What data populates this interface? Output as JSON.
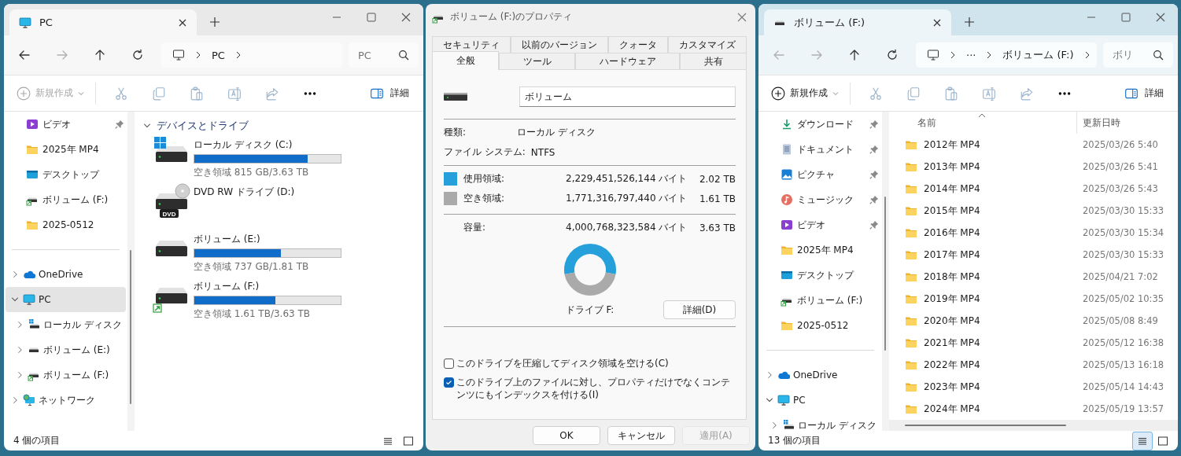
{
  "windows": [
    {
      "kind": "explorer",
      "active": false,
      "tab": {
        "title": "PC",
        "kind": "pc"
      },
      "back_enabled": true,
      "forward_enabled": false,
      "address": [
        "PC"
      ],
      "search": {
        "placeholder": "PC"
      },
      "toolbar": {
        "new_label": "新規作成",
        "new_disabled": true,
        "details_label": "詳細"
      },
      "quick_access": [
        {
          "label": "ビデオ",
          "kind": "video",
          "pinned": true
        },
        {
          "label": "2025年 MP4",
          "kind": "folder",
          "pinned": false
        },
        {
          "label": "デスクトップ",
          "kind": "desktop",
          "pinned": false
        },
        {
          "label": "ボリューム (F:)",
          "kind": "drive-shared",
          "pinned": false
        },
        {
          "label": "2025-0512",
          "kind": "folder",
          "pinned": false
        }
      ],
      "tree": [
        {
          "label": "OneDrive",
          "kind": "onedrive",
          "expanded": false,
          "selected": false
        },
        {
          "label": "PC",
          "kind": "pc",
          "expanded": true,
          "selected": true,
          "children": [
            {
              "label": "ローカル ディスク",
              "kind": "drive-system",
              "expanded": false,
              "selected": false
            },
            {
              "label": "ボリューム (E:)",
              "kind": "drive",
              "expanded": false,
              "selected": false
            },
            {
              "label": "ボリューム (F:)",
              "kind": "drive-shared",
              "expanded": false,
              "selected": false
            }
          ]
        },
        {
          "label": "ネットワーク",
          "kind": "network",
          "expanded": false,
          "selected": false
        }
      ],
      "content": {
        "kind": "drives",
        "group": {
          "title": "デバイスとドライブ",
          "expanded": true
        },
        "drives": [
          {
            "name": "ローカル ディスク (C:)",
            "kind": "system",
            "level": 0.776,
            "free": "空き領域 815 GB/3.63 TB"
          },
          {
            "name": "DVD RW ドライブ (D:)",
            "kind": "dvd",
            "badge": "DVD"
          },
          {
            "name": "ボリューム (E:)",
            "kind": "drive",
            "level": 0.593,
            "free": "空き領域 737 GB/1.81 TB"
          },
          {
            "name": "ボリューム (F:)",
            "kind": "shared",
            "level": 0.556,
            "free": "空き領域 1.61 TB/3.63 TB"
          }
        ]
      },
      "status": {
        "text": "4 個の項目",
        "views": [
          {
            "kind": "details",
            "selected": false
          },
          {
            "kind": "tiles",
            "selected": false
          }
        ]
      }
    },
    {
      "kind": "properties",
      "title": "ボリューム (F:)のプロパティ",
      "tab_rows": [
        {
          "tabs": [
            {
              "label": "セキュリティ",
              "selected": false
            },
            {
              "label": "以前のバージョン",
              "selected": false
            },
            {
              "label": "クォータ",
              "selected": false
            },
            {
              "label": "カスタマイズ",
              "selected": false
            }
          ]
        },
        {
          "tabs": [
            {
              "label": "全般",
              "selected": true
            },
            {
              "label": "ツール",
              "selected": false
            },
            {
              "label": "ハードウェア",
              "selected": false
            },
            {
              "label": "共有",
              "selected": false
            }
          ]
        }
      ],
      "name_value": "ボリューム",
      "info": [
        {
          "label": "種類:",
          "value": "ローカル ディスク"
        },
        {
          "label": "ファイル システム:",
          "value": "NTFS"
        }
      ],
      "usage": [
        {
          "label": "使用領域:",
          "bytes": "2,229,451,526,144 バイト",
          "size": "2.02 TB",
          "color": "#26a0da"
        },
        {
          "label": "空き領域:",
          "bytes": "1,771,316,797,440 バイト",
          "size": "1.61 TB",
          "color": "#aaaaaa"
        }
      ],
      "capacity": {
        "label": "容量:",
        "bytes": "4,000,768,323,584 バイト",
        "size": "3.63 TB"
      },
      "chart_data": {
        "type": "donut",
        "values": [
          55.7,
          44.3
        ]
      },
      "drive_label": "ドライブ F:",
      "details_button": "詳細(D)",
      "options": [
        {
          "label": "このドライブを圧縮してディスク領域を空ける(C)",
          "checked": false
        },
        {
          "label": "このドライブ上のファイルに対し、プロパティだけでなくコンテンツにもインデックスを付ける(I)",
          "checked": true
        }
      ],
      "buttons": [
        {
          "label": "OK",
          "disabled": false
        },
        {
          "label": "キャンセル",
          "disabled": false
        },
        {
          "label": "適用(A)",
          "disabled": true
        }
      ]
    },
    {
      "kind": "explorer",
      "active": true,
      "tab": {
        "title": "ボリューム (F:)",
        "kind": "drive"
      },
      "back_enabled": false,
      "forward_enabled": false,
      "address": [
        "···",
        "ボリューム (F:)"
      ],
      "search": {
        "placeholder": "ボリ"
      },
      "toolbar": {
        "new_label": "新規作成",
        "new_disabled": false,
        "details_label": "詳細"
      },
      "quick_access": [
        {
          "label": "ダウンロード",
          "kind": "download",
          "pinned": true
        },
        {
          "label": "ドキュメント",
          "kind": "document",
          "pinned": true
        },
        {
          "label": "ピクチャ",
          "kind": "picture",
          "pinned": true
        },
        {
          "label": "ミュージック",
          "kind": "music",
          "pinned": true
        },
        {
          "label": "ビデオ",
          "kind": "video",
          "pinned": true
        },
        {
          "label": "2025年 MP4",
          "kind": "folder",
          "pinned": false
        },
        {
          "label": "デスクトップ",
          "kind": "desktop",
          "pinned": false
        },
        {
          "label": "ボリューム (F:)",
          "kind": "drive-shared",
          "pinned": false
        },
        {
          "label": "2025-0512",
          "kind": "folder",
          "pinned": false
        }
      ],
      "tree": [
        {
          "label": "OneDrive",
          "kind": "onedrive",
          "expanded": false,
          "selected": false
        },
        {
          "label": "PC",
          "kind": "pc",
          "expanded": true,
          "selected": false,
          "children": [
            {
              "label": "ローカル ディスク",
              "kind": "drive-system",
              "expanded": false,
              "selected": false
            }
          ]
        }
      ],
      "content": {
        "kind": "details",
        "columns": [
          {
            "label": "名前",
            "sorted": true
          },
          {
            "label": "更新日時",
            "sorted": false
          }
        ],
        "rows": [
          {
            "name": "2012年 MP4",
            "date": "2025/03/26 5:40"
          },
          {
            "name": "2013年 MP4",
            "date": "2025/03/26 5:41"
          },
          {
            "name": "2014年 MP4",
            "date": "2025/03/26 5:43"
          },
          {
            "name": "2015年 MP4",
            "date": "2025/03/30 15:33"
          },
          {
            "name": "2016年 MP4",
            "date": "2025/03/30 15:34"
          },
          {
            "name": "2017年 MP4",
            "date": "2025/03/30 15:33"
          },
          {
            "name": "2018年 MP4",
            "date": "2025/04/21 7:02"
          },
          {
            "name": "2019年 MP4",
            "date": "2025/05/02 10:35"
          },
          {
            "name": "2020年 MP4",
            "date": "2025/05/08 8:49"
          },
          {
            "name": "2021年 MP4",
            "date": "2025/05/12 16:38"
          },
          {
            "name": "2022年 MP4",
            "date": "2025/05/13 16:18"
          },
          {
            "name": "2023年 MP4",
            "date": "2025/05/14 14:43"
          },
          {
            "name": "2024年 MP4",
            "date": "2025/05/19 13:57"
          }
        ]
      },
      "status": {
        "text": "13 個の項目",
        "views": [
          {
            "kind": "details",
            "selected": true
          },
          {
            "kind": "tiles",
            "selected": false
          }
        ]
      }
    }
  ]
}
